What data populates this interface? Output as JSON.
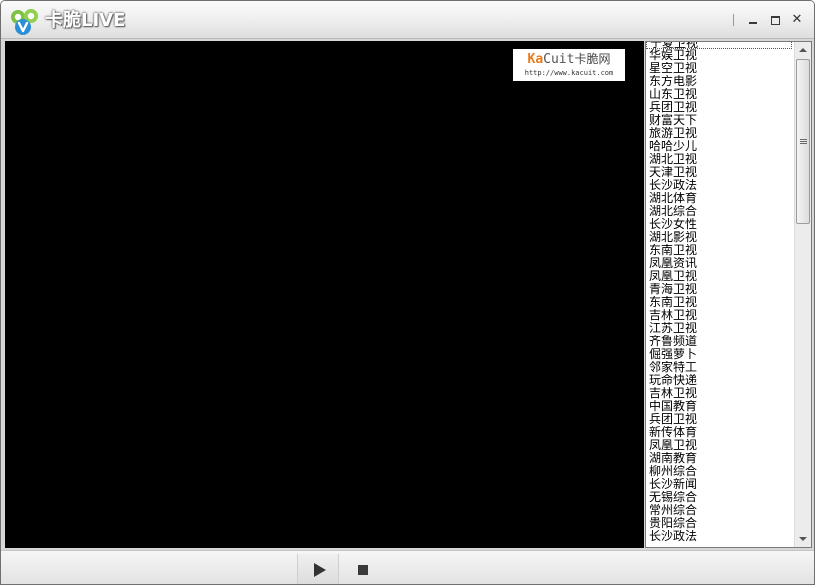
{
  "window": {
    "title": "卡脆LIVE",
    "minimize_icon": "minimize-icon",
    "maximize_icon": "maximize-icon",
    "close_icon": "close-icon",
    "close_glyph": "✕"
  },
  "watermark": {
    "brand_ka": "Ka",
    "brand_cuit": "Cuit",
    "brand_cn": "卡脆网",
    "url": "http://www.kacuit.com"
  },
  "channels": [
    "宁夏卫视",
    "华娱卫视",
    "星空卫视",
    "东方电影",
    "山东卫视",
    "兵团卫视",
    "财富天下",
    "旅游卫视",
    "哈哈少儿",
    "湖北卫视",
    "天津卫视",
    "长沙政法",
    "湖北体育",
    "湖北综合",
    "长沙女性",
    "湖北影视",
    "东南卫视",
    "凤凰资讯",
    "凤凰卫视",
    "青海卫视",
    "东南卫视",
    "吉林卫视",
    "江苏卫视",
    "齐鲁频道",
    "倔强萝卜",
    "邻家特工",
    "玩命快递",
    "吉林卫视",
    "中国教育",
    "兵团卫视",
    "新传体育",
    "凤凰卫视",
    "湖南教育",
    "柳州综合",
    "长沙新闻",
    "无锡综合",
    "常州综合",
    "贵阳综合",
    "长沙政法"
  ],
  "controls": {
    "play_icon": "play-icon",
    "stop_icon": "stop-icon"
  },
  "colors": {
    "accent_orange": "#e87a1c",
    "video_bg": "#000000"
  }
}
